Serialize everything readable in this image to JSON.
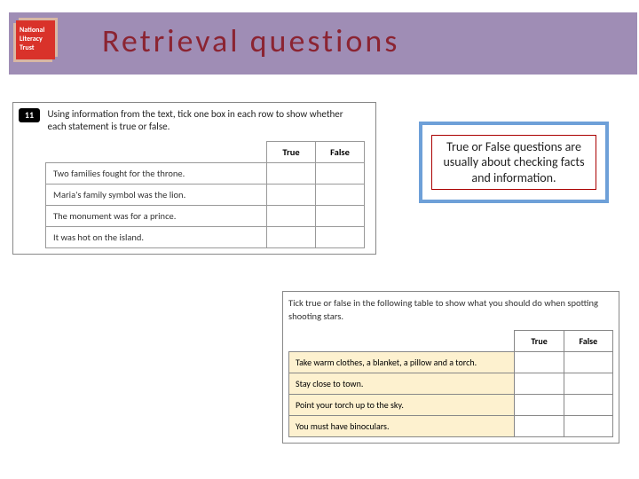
{
  "header": {
    "logo_text": "National Literacy Trust",
    "title": "Retrieval questions"
  },
  "callout": {
    "text": "True or False questions are usually about checking facts and information."
  },
  "question1": {
    "number": "11",
    "instruction": "Using information from the text, tick one box in each row to show whether each statement is true or false.",
    "col_true": "True",
    "col_false": "False",
    "rows": [
      "Two families fought for the throne.",
      "Maria's family symbol was the lion.",
      "The monument was for a prince.",
      "It was hot on the island."
    ]
  },
  "question2": {
    "instruction": "Tick true or false in the following table to show what you should do when spotting shooting stars.",
    "col_true": "True",
    "col_false": "False",
    "rows": [
      "Take warm clothes, a blanket, a pillow and a torch.",
      "Stay close to town.",
      "Point your torch up to the sky.",
      "You must have binoculars."
    ]
  }
}
